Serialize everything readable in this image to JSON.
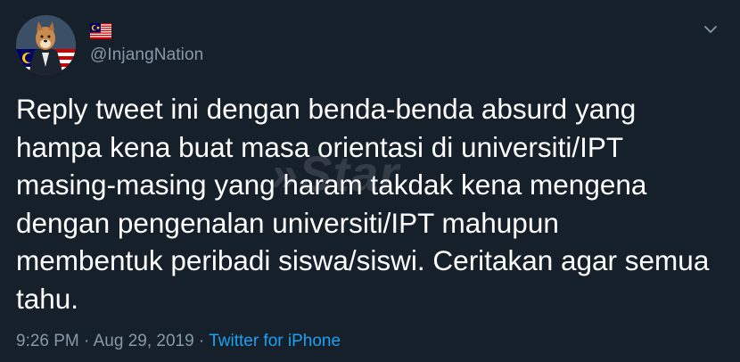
{
  "tweet": {
    "handle": "@InjangNation",
    "text": "Reply tweet ini dengan benda-benda absurd yang\nhampa kena buat masa orientasi di universiti/IPT\nmasing-masing yang haram takdak kena mengena\ndengan pengenalan universiti/IPT mahupun\nmembentuk peribadi siswa/siswi. Ceritakan agar semua\ntahu.",
    "time": "9:26 PM",
    "separator1": " · ",
    "date": "Aug 29, 2019",
    "separator2": " · ",
    "source": "Twitter for iPhone"
  },
  "watermark": "»Star",
  "icons": {
    "avatar": "avatar-image",
    "flag": "malaysia-flag-icon",
    "menu": "chevron-down-icon"
  },
  "colors": {
    "background": "#15202b",
    "text": "#ffffff",
    "secondary": "#8899a6",
    "link": "#1da1f2"
  }
}
